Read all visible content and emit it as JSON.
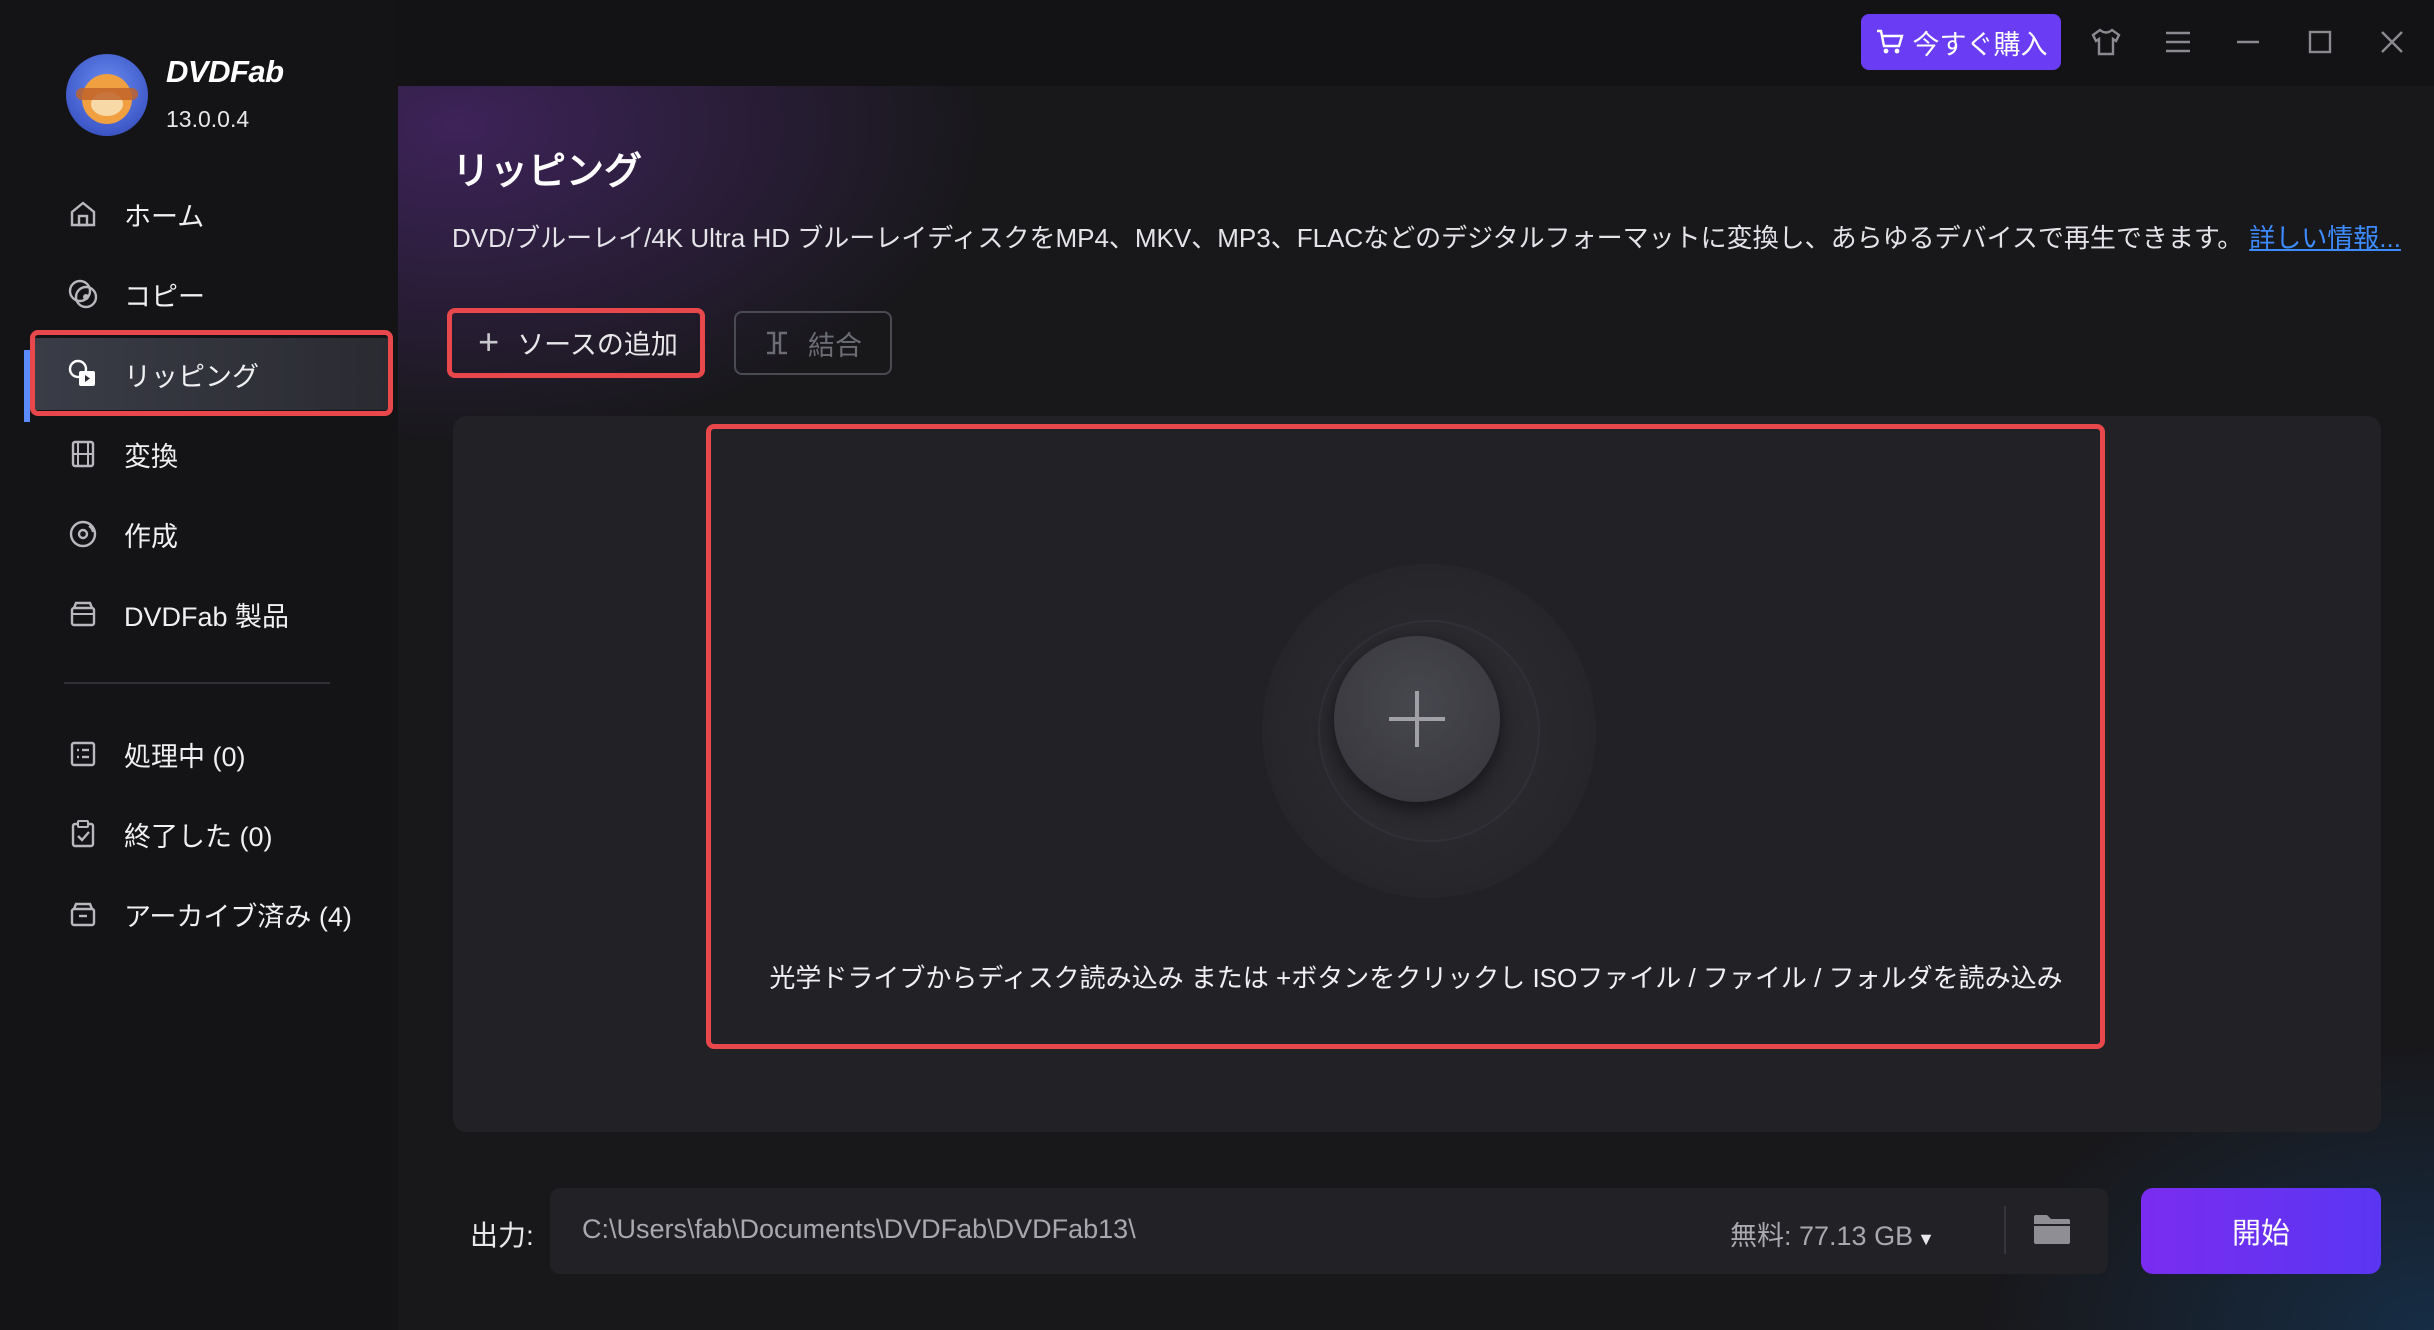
{
  "app": {
    "brand": "DVDFab",
    "version": "13.0.0.4"
  },
  "topbar": {
    "buy_label": "今すぐ購入",
    "accent": "#6a3df5"
  },
  "sidebar": {
    "items": [
      {
        "label": "ホーム",
        "icon": "home-icon"
      },
      {
        "label": "コピー",
        "icon": "copy-disc-icon"
      },
      {
        "label": "リッピング",
        "icon": "ripper-icon",
        "active": true
      },
      {
        "label": "変換",
        "icon": "film-icon"
      },
      {
        "label": "作成",
        "icon": "creator-disc-icon"
      },
      {
        "label": "DVDFab 製品",
        "icon": "box-icon"
      }
    ],
    "task_items": [
      {
        "label": "処理中 (0)",
        "icon": "task-list-icon"
      },
      {
        "label": "終了した (0)",
        "icon": "clipboard-check-icon"
      },
      {
        "label": "アーカイブ済み (4)",
        "icon": "archive-icon"
      }
    ],
    "active_color": "#5b8cff"
  },
  "main": {
    "title": "リッピング",
    "description": "DVD/ブルーレイ/4K Ultra HD ブルーレイディスクをMP4、MKV、MP3、FLACなどのデジタルフォーマットに変換し、あらゆるデバイスで再生できます。",
    "more_link": "詳しい情報...",
    "add_source_label": "ソースの追加",
    "merge_label": "結合",
    "drop_hint": "光学ドライブからディスク読み込み または +ボタンをクリックし ISOファイル / ファイル / フォルダを読み込み"
  },
  "output": {
    "label": "出力:",
    "path": "C:\\Users\\fab\\Documents\\DVDFab\\DVDFab13\\",
    "free_space": "無料: 77.13 GB",
    "start_label": "開始"
  },
  "highlight_color": "#e8484b"
}
